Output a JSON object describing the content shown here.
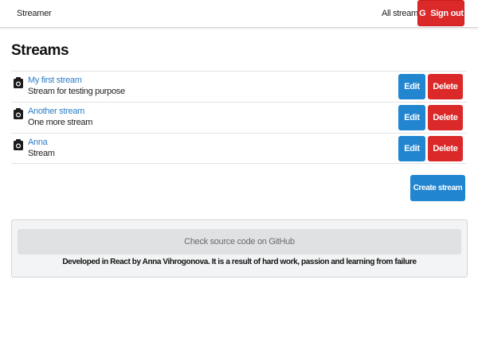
{
  "header": {
    "brand": "Streamer",
    "nav_all_streams": "All streams",
    "signout_icon": "G",
    "signout_label": "Sign out"
  },
  "page_title": "Streams",
  "streams": [
    {
      "title": "My first stream",
      "description": "Stream for testing purpose",
      "edit_label": "Edit",
      "delete_label": "Delete",
      "icon": "camera-icon"
    },
    {
      "title": "Another stream",
      "description": "One more stream",
      "edit_label": "Edit",
      "delete_label": "Delete",
      "icon": "camera-icon"
    },
    {
      "title": "Anna",
      "description": "Stream",
      "edit_label": "Edit",
      "delete_label": "Delete",
      "icon": "camera-icon"
    }
  ],
  "create_label": "Create stream",
  "footer": {
    "github_label": "Check source code on GitHub",
    "credit": "Developed in React by Anna Vihrogonova. It is a result of hard work, passion and learning from failure"
  },
  "colors": {
    "primary": "#2185d0",
    "danger": "#db2828",
    "link": "#2f7dc5"
  }
}
